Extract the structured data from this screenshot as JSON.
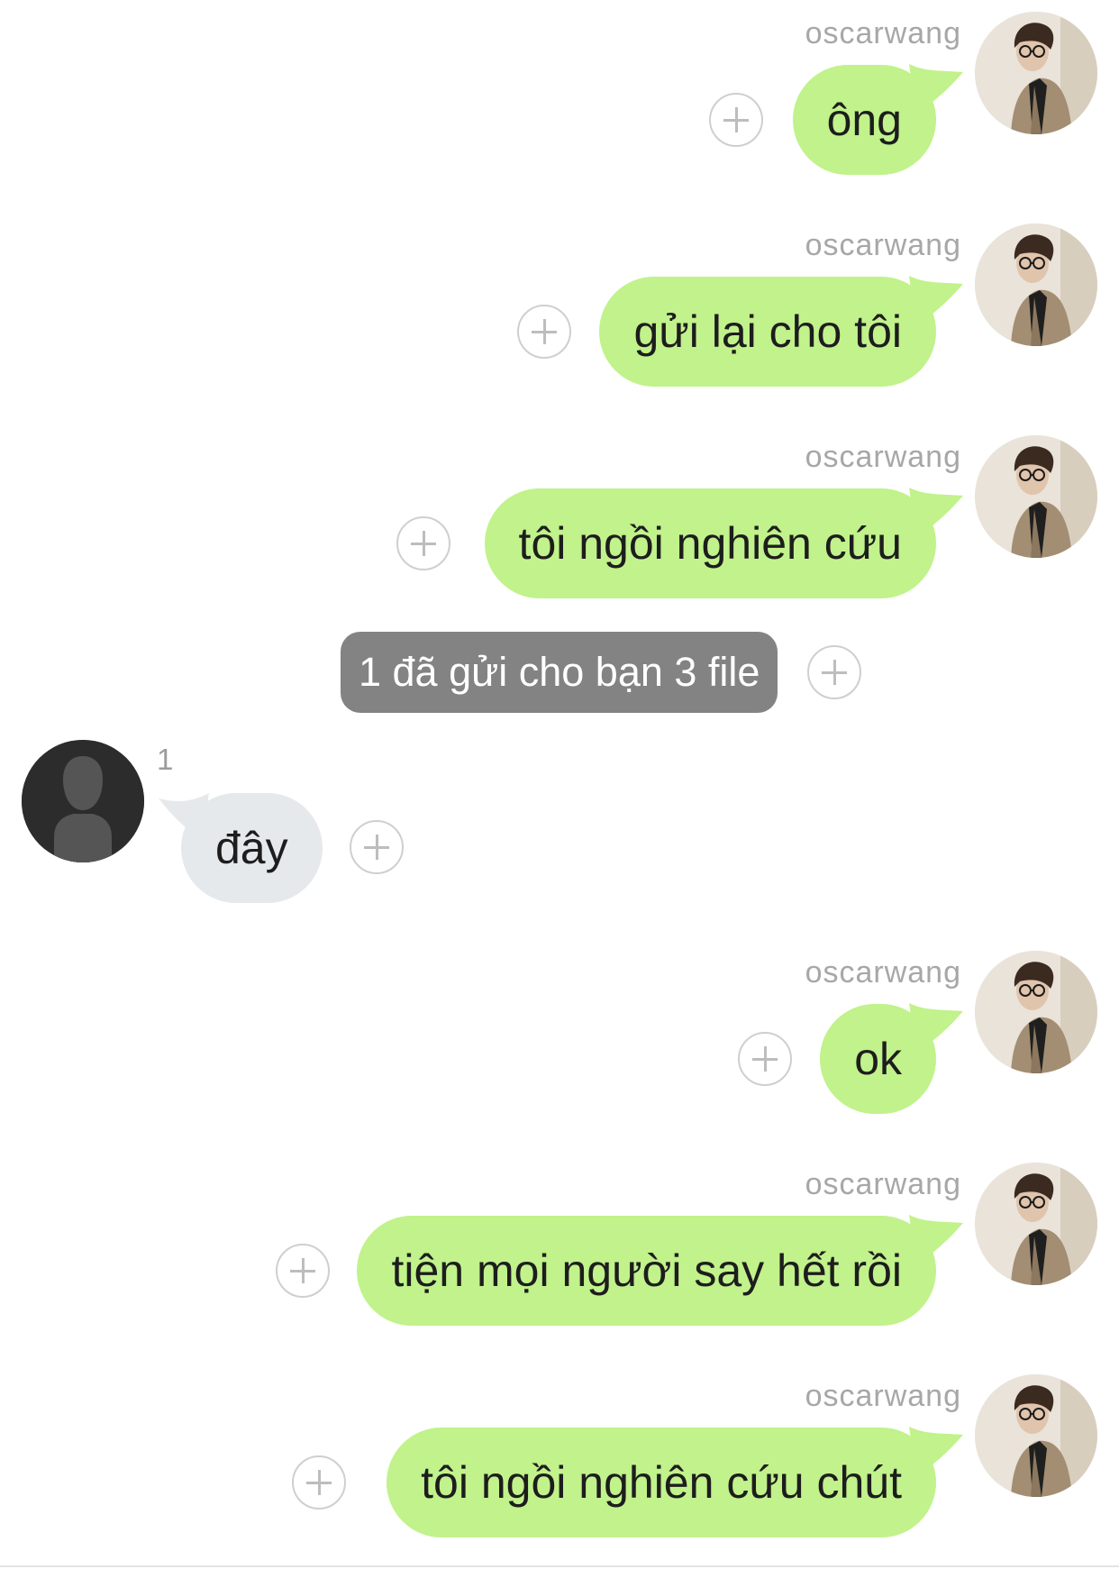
{
  "colors": {
    "outgoing_bubble": "#c1f28b",
    "incoming_bubble": "#e6e9ec",
    "system_pill": "#838383",
    "sender_name": "#a7a7a7"
  },
  "messages": [
    {
      "direction": "outgoing",
      "sender": "oscarwang",
      "text": "ông"
    },
    {
      "direction": "outgoing",
      "sender": "oscarwang",
      "text": "gửi lại cho tôi"
    },
    {
      "direction": "outgoing",
      "sender": "oscarwang",
      "text": "tôi ngồi nghiên cứu"
    },
    {
      "direction": "system",
      "text": "1 đã gửi cho bạn 3 file"
    },
    {
      "direction": "incoming",
      "read_count": "1",
      "text": "đây"
    },
    {
      "direction": "outgoing",
      "sender": "oscarwang",
      "text": "ok"
    },
    {
      "direction": "outgoing",
      "sender": "oscarwang",
      "text": "tiện mọi người say hết rồi"
    },
    {
      "direction": "outgoing",
      "sender": "oscarwang",
      "text": "tôi ngồi nghiên cứu chút"
    }
  ],
  "icons": {
    "action": "plus-circle-icon",
    "sender_avatar": "user-avatar-photo",
    "contact_avatar": "default-silhouette-avatar"
  }
}
